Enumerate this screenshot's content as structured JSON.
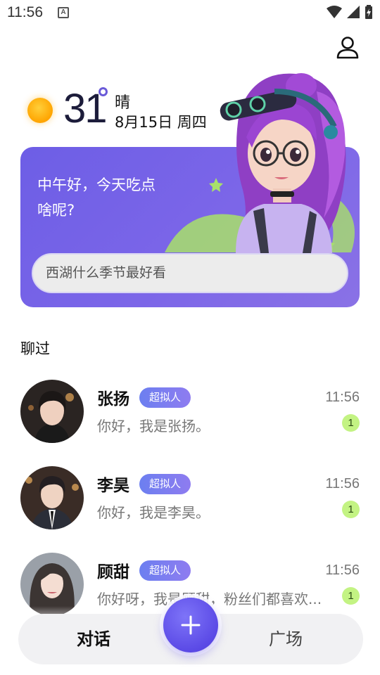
{
  "status_bar": {
    "time": "11:56",
    "a_badge": "A"
  },
  "weather": {
    "temperature": "31",
    "condition": "晴",
    "date": "8月15日 周四"
  },
  "hero": {
    "greeting": "中午好，今天吃点啥呢?",
    "search_placeholder": "西湖什么季节最好看"
  },
  "chats": {
    "section_title": "聊过",
    "items": [
      {
        "name": "张扬",
        "badge": "超拟人",
        "time": "11:56",
        "message": "你好，我是张扬。",
        "unread": "1"
      },
      {
        "name": "李昊",
        "badge": "超拟人",
        "time": "11:56",
        "message": "你好，我是李昊。",
        "unread": "1"
      },
      {
        "name": "顾甜",
        "badge": "超拟人",
        "time": "11:56",
        "message": "你好呀，我是顾甜，粉丝们都喜欢...",
        "unread": "1"
      }
    ]
  },
  "bottom_nav": {
    "left_tab": "对话",
    "right_tab": "广场",
    "fab_icon": "plus-icon"
  },
  "colors": {
    "accent": "#6d5ee6",
    "unread": "#c3f383",
    "sun": "#ffa400"
  }
}
